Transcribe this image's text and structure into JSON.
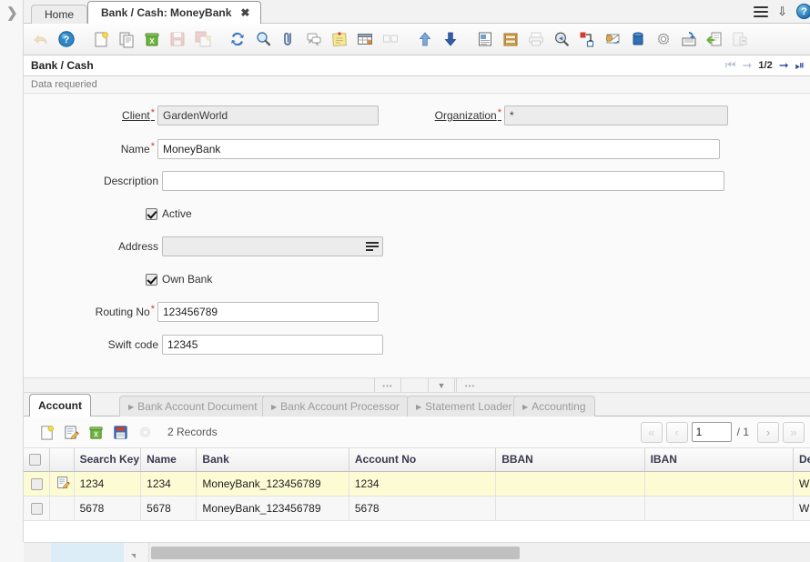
{
  "window_tabs": {
    "expand_icon": "chevron-right-icon",
    "items": [
      {
        "label": "Home",
        "active": false,
        "closable": false
      },
      {
        "label": "Bank / Cash: MoneyBank",
        "active": true,
        "closable": true,
        "close_glyph": "✖"
      }
    ],
    "menu_icon": "hamburger-menu-icon",
    "collapse_icon": "double-chevron-down-icon",
    "help_icon": "help-circle-icon",
    "help_glyph": "?"
  },
  "toolbar": {
    "buttons": [
      {
        "name": "undo-button",
        "icon": "undo-arrow-icon",
        "disabled": true
      },
      {
        "name": "help-button",
        "icon": "help-circle-icon",
        "disabled": false
      },
      {
        "name": "new-record-button",
        "icon": "new-document-icon",
        "disabled": false
      },
      {
        "name": "copy-record-button",
        "icon": "copy-documents-icon",
        "disabled": false
      },
      {
        "name": "delete-record-button",
        "icon": "recycle-bin-icon",
        "disabled": false
      },
      {
        "name": "save-button",
        "icon": "floppy-disk-icon",
        "disabled": true
      },
      {
        "name": "save-create-button",
        "icon": "save-new-icon",
        "disabled": true
      },
      {
        "name": "refresh-button",
        "icon": "refresh-arrows-icon",
        "disabled": false
      },
      {
        "name": "find-button",
        "icon": "magnifier-icon",
        "disabled": false
      },
      {
        "name": "attachment-button",
        "icon": "paperclip-icon",
        "disabled": false
      },
      {
        "name": "chat-button",
        "icon": "chat-bubbles-icon",
        "disabled": false
      },
      {
        "name": "note-button",
        "icon": "sticky-note-icon",
        "disabled": false
      },
      {
        "name": "grid-toggle-button",
        "icon": "grid-table-icon",
        "disabled": false
      },
      {
        "name": "multi-window-button",
        "icon": "two-panes-icon",
        "disabled": true
      },
      {
        "name": "parent-record-button",
        "icon": "up-arrow-icon",
        "disabled": false
      },
      {
        "name": "detail-record-button",
        "icon": "down-arrow-icon",
        "disabled": false
      },
      {
        "name": "report-button",
        "icon": "report-window-icon",
        "disabled": false
      },
      {
        "name": "archive-button",
        "icon": "archive-drawer-icon",
        "disabled": false
      },
      {
        "name": "print-button",
        "icon": "printer-icon",
        "disabled": true
      },
      {
        "name": "print-preview-button",
        "icon": "print-preview-icon",
        "disabled": false
      },
      {
        "name": "zoom-across-button",
        "icon": "zoom-across-icon",
        "disabled": false
      },
      {
        "name": "request-button",
        "icon": "mail-request-icon",
        "disabled": false
      },
      {
        "name": "product-info-button",
        "icon": "blue-cylinder-icon",
        "disabled": false
      },
      {
        "name": "preference-button",
        "icon": "gear-icon",
        "disabled": false
      },
      {
        "name": "export-button",
        "icon": "export-disk-icon",
        "disabled": false
      },
      {
        "name": "import-button",
        "icon": "import-file-icon",
        "disabled": false
      },
      {
        "name": "exit-button",
        "icon": "exit-door-icon",
        "disabled": true
      }
    ]
  },
  "window_header": {
    "title": "Bank / Cash",
    "nav": {
      "first_icon": "nav-first-icon",
      "prev_icon": "nav-prev-icon",
      "position": "1/2",
      "next_icon": "nav-next-icon",
      "last_icon": "nav-last-icon"
    }
  },
  "status": {
    "message": "Data requeried"
  },
  "form": {
    "fields": [
      {
        "name": "client",
        "label": "Client",
        "value": "GardenWorld",
        "required": true,
        "link": true,
        "readonly": true,
        "type": "text"
      },
      {
        "name": "organization",
        "label": "Organization",
        "value": "*",
        "required": true,
        "link": true,
        "readonly": true,
        "type": "text"
      },
      {
        "name": "name",
        "label": "Name",
        "value": "MoneyBank",
        "required": true,
        "link": false,
        "readonly": false,
        "type": "text"
      },
      {
        "name": "description",
        "label": "Description",
        "value": "",
        "required": false,
        "link": false,
        "readonly": false,
        "type": "text"
      },
      {
        "name": "active",
        "label": "Active",
        "value": "",
        "required": false,
        "link": false,
        "readonly": false,
        "type": "checkbox",
        "checked": true
      },
      {
        "name": "address",
        "label": "Address",
        "value": "",
        "required": false,
        "link": false,
        "readonly": true,
        "type": "lookup"
      },
      {
        "name": "own_bank",
        "label": "Own Bank",
        "value": "",
        "required": false,
        "link": false,
        "readonly": false,
        "type": "checkbox",
        "checked": true
      },
      {
        "name": "routing_no",
        "label": "Routing No",
        "value": "123456789",
        "required": true,
        "link": false,
        "readonly": false,
        "type": "text"
      },
      {
        "name": "swift_code",
        "label": "Swift code",
        "value": "12345",
        "required": false,
        "link": false,
        "readonly": false,
        "type": "text"
      }
    ]
  },
  "splitter": {
    "left_dots": "•••",
    "chevron": "▼",
    "right_dots": "•••"
  },
  "detail_tabs": [
    {
      "label": "Account",
      "active": true
    },
    {
      "label": "Bank Account Document",
      "active": false
    },
    {
      "label": "Bank Account Processor",
      "active": false
    },
    {
      "label": "Statement Loader",
      "active": false
    },
    {
      "label": "Accounting",
      "active": false
    }
  ],
  "grid_toolbar": {
    "buttons": [
      {
        "name": "grid-new-button",
        "icon": "new-document-icon",
        "disabled": false
      },
      {
        "name": "grid-edit-button",
        "icon": "edit-record-icon",
        "disabled": false
      },
      {
        "name": "grid-delete-button",
        "icon": "recycle-bin-icon",
        "disabled": false
      },
      {
        "name": "grid-save-button",
        "icon": "floppy-disk-icon",
        "disabled": false
      },
      {
        "name": "grid-settings-button",
        "icon": "gear-icon",
        "disabled": true
      }
    ],
    "record_count": "2 Records",
    "pager": {
      "first_glyph": "«",
      "prev_glyph": "‹",
      "page_value": "1",
      "total": "/ 1",
      "next_glyph": "›",
      "last_glyph": "»"
    }
  },
  "grid": {
    "columns": [
      "Search Key",
      "Name",
      "Bank",
      "Account No",
      "BBAN",
      "IBAN",
      "Description"
    ],
    "rows": [
      {
        "selected": true,
        "edit_icon": "edit-record-icon",
        "cells": [
          "1234",
          "1234",
          "MoneyBank_123456789",
          "1234",
          "",
          "",
          "With P"
        ]
      },
      {
        "selected": false,
        "edit_icon": "",
        "cells": [
          "5678",
          "5678",
          "MoneyBank_123456789",
          "5678",
          "",
          "",
          "With C"
        ]
      }
    ]
  }
}
